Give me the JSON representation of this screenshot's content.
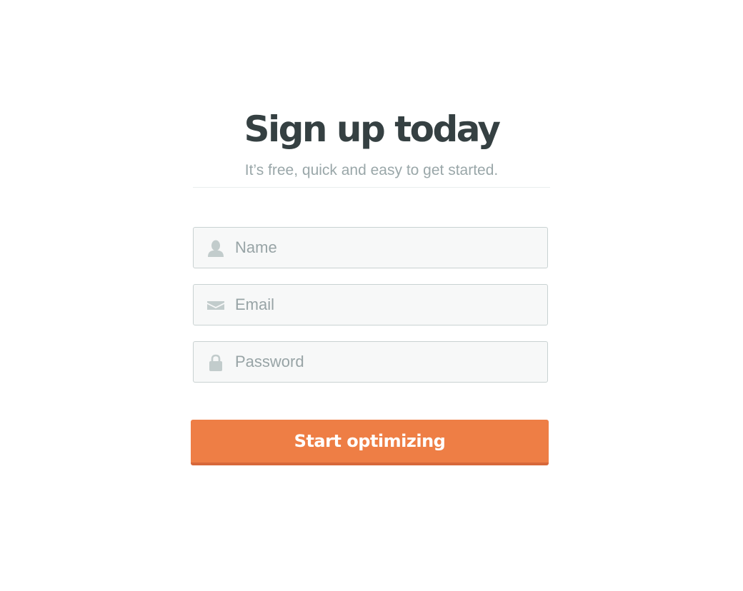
{
  "header": {
    "title": "Sign up today",
    "subtitle": "It’s free, quick and easy to get started."
  },
  "form": {
    "fields": [
      {
        "name": "name",
        "icon": "user-icon",
        "placeholder": "Name",
        "value": ""
      },
      {
        "name": "email",
        "icon": "envelope-icon",
        "placeholder": "Email",
        "value": ""
      },
      {
        "name": "password",
        "icon": "lock-icon",
        "placeholder": "Password",
        "value": ""
      }
    ],
    "submit_label": "Start optimizing"
  },
  "colors": {
    "title": "#354042",
    "subtitle": "#9aa7a9",
    "field_background": "#f7f8f8",
    "field_border": "#c9d2d2",
    "icon": "#c2cccc",
    "accent": "#ee7e45",
    "accent_shadow": "#d7683a"
  }
}
